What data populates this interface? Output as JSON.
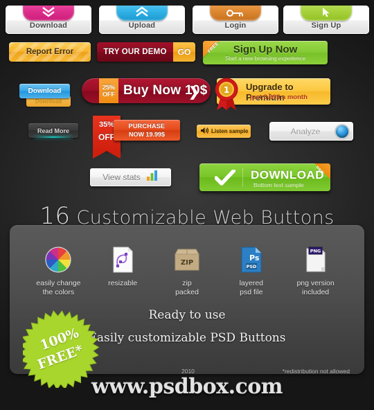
{
  "top_cards": [
    {
      "label": "Download",
      "icon": "double-chevron-down-icon",
      "color": "#e0318f"
    },
    {
      "label": "Upload",
      "icon": "double-chevron-up-icon",
      "color": "#35b5e8"
    },
    {
      "label": "Login",
      "icon": "key-icon",
      "color": "#e08a34"
    },
    {
      "label": "Sign Up",
      "icon": "cursor-arrow-icon",
      "color": "#aad440"
    }
  ],
  "report_error": {
    "label": "Report Error"
  },
  "demo": {
    "label": "TRY OUR DEMO",
    "go_label": "GO"
  },
  "signup_now": {
    "title": "Sign Up Now",
    "subtitle": "Start a new browsing experience",
    "corner_label": "FREE"
  },
  "download_blue": {
    "label": "Download",
    "shadow_label": "Download"
  },
  "buy_now": {
    "off_top": "25%",
    "off_bottom": "OFF",
    "label": "Buy Now 10$",
    "arrow": "❯"
  },
  "upgrade": {
    "title": "Upgrade to Premium",
    "subtitle": "just 8.99$ a month",
    "badge": "1"
  },
  "read_more": {
    "label": "Read More"
  },
  "purchase": {
    "off_top": "35%",
    "off_bottom": "OFF",
    "line1": "PURCHASE",
    "line2": "NOW  19.99$"
  },
  "listen": {
    "label": "Listen sample",
    "icon": "speaker-icon"
  },
  "analyze": {
    "label": "Analyze",
    "icon": "blue-orb-icon"
  },
  "view_stats": {
    "label": "View stats",
    "icon": "bar-chart-icon"
  },
  "download_green": {
    "title": "DOWNLOAD",
    "subtitle": "Bottom text sample",
    "corner_label": "new",
    "icon": "checkmark-icon"
  },
  "headline": {
    "number": "16",
    "text": "Customizable Web Buttons"
  },
  "features": [
    {
      "label_line1": "easily change",
      "label_line2": "the colors",
      "icon": "color-wheel-icon"
    },
    {
      "label_line1": "resizable",
      "label_line2": "",
      "icon": "vector-path-icon"
    },
    {
      "label_line1": "zip",
      "label_line2": "packed",
      "icon": "zip-archive-icon"
    },
    {
      "label_line1": "layered",
      "label_line2": "psd file",
      "icon": "psd-file-icon"
    },
    {
      "label_line1": "png version",
      "label_line2": "included",
      "icon": "png-file-icon"
    }
  ],
  "ready": {
    "line1": "Ready to use",
    "line2": "Easily customizable PSD Buttons"
  },
  "starburst": {
    "line1": "100%",
    "line2": "FREE*"
  },
  "footer": {
    "year": "2010",
    "note": "*redistribution not allowed",
    "brand": "www.psdbox.com"
  }
}
